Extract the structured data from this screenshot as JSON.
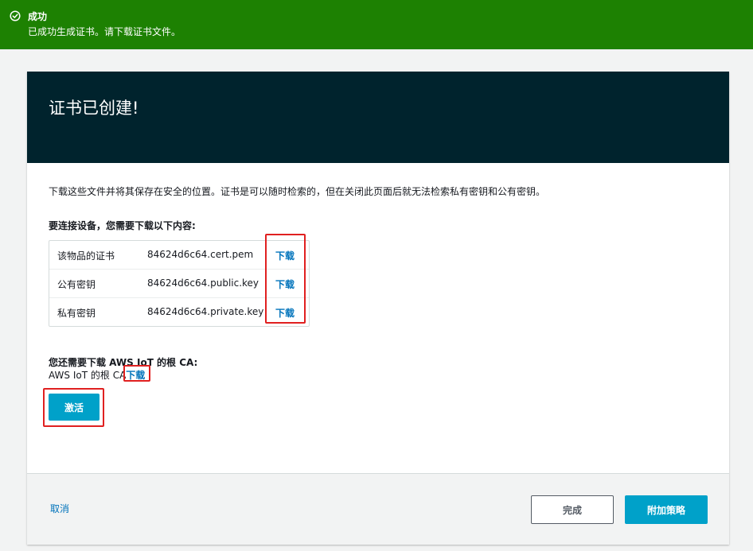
{
  "banner": {
    "title": "成功",
    "message": "已成功生成证书。请下载证书文件。",
    "icon": "check-circle-icon",
    "color": "#1d8102"
  },
  "card": {
    "title": "证书已创建!",
    "description": "下载这些文件并将其保存在安全的位置。证书是可以随时检索的，但在关闭此页面后就无法检索私有密钥和公有密钥。",
    "download_section_title": "要连接设备，您需要下载以下内容:",
    "files": [
      {
        "label": "该物品的证书",
        "filename": "84624d6c64.cert.pem",
        "action": "下载"
      },
      {
        "label": "公有密钥",
        "filename": "84624d6c64.public.key",
        "action": "下载"
      },
      {
        "label": "私有密钥",
        "filename": "84624d6c64.private.key",
        "action": "下载"
      }
    ],
    "ca_title": "您还需要下载 AWS IoT 的根 CA:",
    "ca_text": "AWS IoT 的根 CA",
    "ca_link": "下载",
    "activate_label": "激活"
  },
  "footer": {
    "cancel_label": "取消",
    "done_label": "完成",
    "attach_policy_label": "附加策略"
  },
  "colors": {
    "header_bg": "#00232d",
    "accent": "#00a1c9",
    "link": "#0073bb",
    "highlight": "#e02020"
  }
}
